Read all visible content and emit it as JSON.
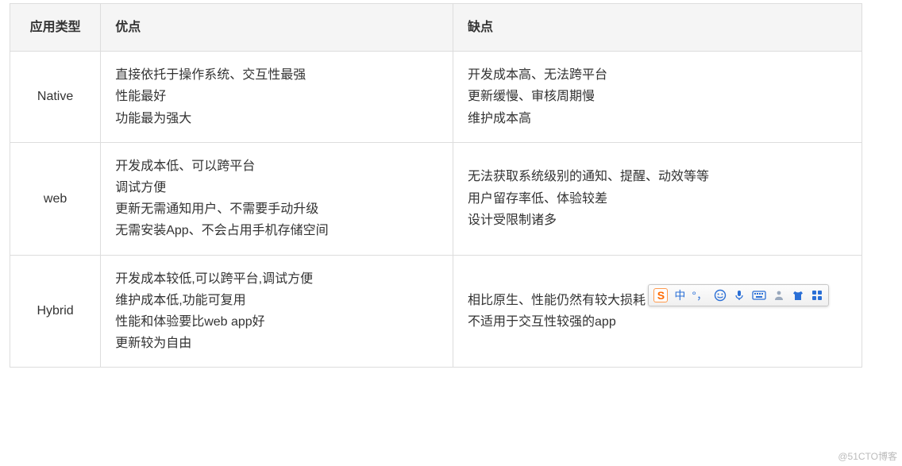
{
  "table": {
    "headers": {
      "col1": "应用类型",
      "col2": "优点",
      "col3": "缺点"
    },
    "rows": [
      {
        "type": "Native",
        "pros": "直接依托于操作系统、交互性最强\n性能最好\n功能最为强大",
        "cons": "开发成本高、无法跨平台\n更新缓慢、审核周期慢\n维护成本高"
      },
      {
        "type": "web",
        "pros": "开发成本低、可以跨平台\n调试方便\n更新无需通知用户、不需要手动升级\n无需安装App、不会占用手机存储空间",
        "cons": "无法获取系统级别的通知、提醒、动效等等\n用户留存率低、体验较差\n设计受限制诸多"
      },
      {
        "type": "Hybrid",
        "pros": "开发成本较低,可以跨平台,调试方便\n维护成本低,功能可复用\n性能和体验要比web app好\n更新较为自由",
        "cons": "相比原生、性能仍然有较大损耗\n不适用于交互性较强的app"
      }
    ]
  },
  "ime": {
    "logo": "S",
    "lang": "中",
    "punct": "°，"
  },
  "watermark": "@51CTO博客"
}
